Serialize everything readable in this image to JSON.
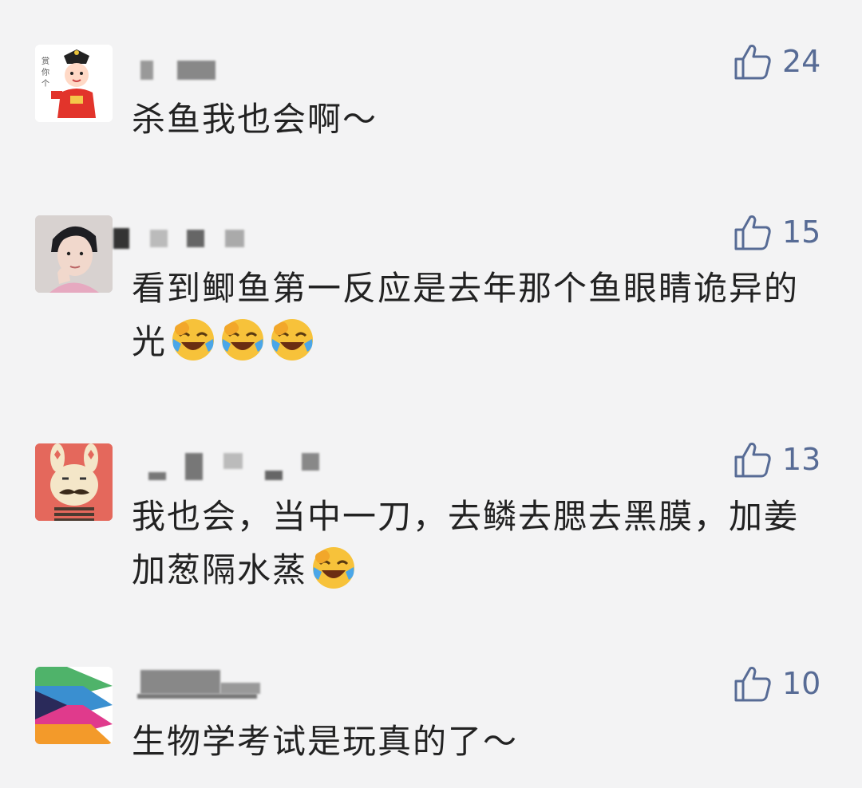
{
  "comments": [
    {
      "text": "杀鱼我也会啊～",
      "likes": "24",
      "emoji_count": 0
    },
    {
      "text": "看到鲫鱼第一反应是去年那个鱼眼睛诡异的光",
      "likes": "15",
      "emoji_count": 3
    },
    {
      "text": "我也会，当中一刀，去鳞去腮去黑膜，加姜加葱隔水蒸",
      "likes": "13",
      "emoji_count": 1
    },
    {
      "text": "生物学考试是玩真的了～",
      "likes": "10",
      "emoji_count": 0
    }
  ],
  "colors": {
    "background": "#f3f3f4",
    "like_accent": "#576b95",
    "text": "#222222"
  },
  "icons": {
    "like": "thumbs-up-outline-icon",
    "emoji": "laughing-crying-emoji-icon"
  }
}
